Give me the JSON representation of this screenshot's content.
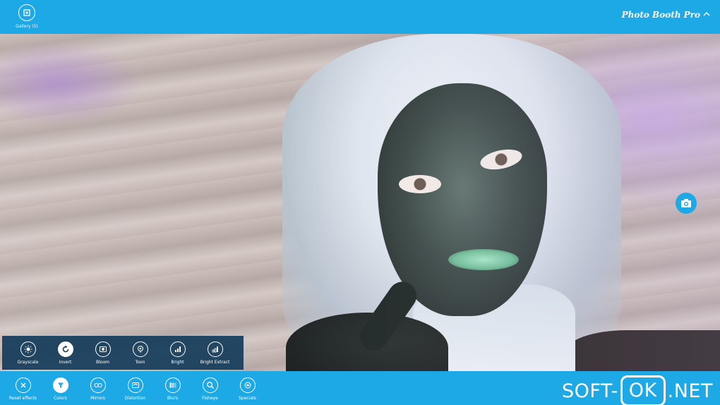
{
  "header": {
    "gallery_icon": "gallery-icon",
    "gallery_label": "Gallery (5)",
    "app_title": "Photo Booth Pro",
    "chevron": "^"
  },
  "effects_submenu": {
    "items": [
      {
        "label": "Grayscale",
        "icon": "sun-icon",
        "selected": false
      },
      {
        "label": "Invert",
        "icon": "refresh-icon",
        "selected": true
      },
      {
        "label": "Bloom",
        "icon": "bloom-icon",
        "selected": false
      },
      {
        "label": "Toon",
        "icon": "toon-icon",
        "selected": false
      },
      {
        "label": "Bright",
        "icon": "bars-icon",
        "selected": false
      },
      {
        "label": "Bright Extract",
        "icon": "bars-icon",
        "selected": false
      }
    ]
  },
  "app_bar": {
    "items": [
      {
        "label": "Reset effects",
        "icon": "close-icon",
        "selected": false
      },
      {
        "label": "Colors",
        "icon": "filter-icon",
        "selected": true
      },
      {
        "label": "Mirrors",
        "icon": "mirror-icon",
        "selected": false
      },
      {
        "label": "Distortion",
        "icon": "distortion-icon",
        "selected": false
      },
      {
        "label": "Blurs",
        "icon": "blur-icon",
        "selected": false
      },
      {
        "label": "Fisheye",
        "icon": "magnifier-icon",
        "selected": false
      },
      {
        "label": "Specials",
        "icon": "specials-icon",
        "selected": false
      }
    ]
  },
  "watermark": {
    "part1": "SOFT-",
    "part2": "OK",
    "part3": ".NET"
  },
  "colors": {
    "accent": "#1da8e6",
    "panel": "#143c5a"
  }
}
